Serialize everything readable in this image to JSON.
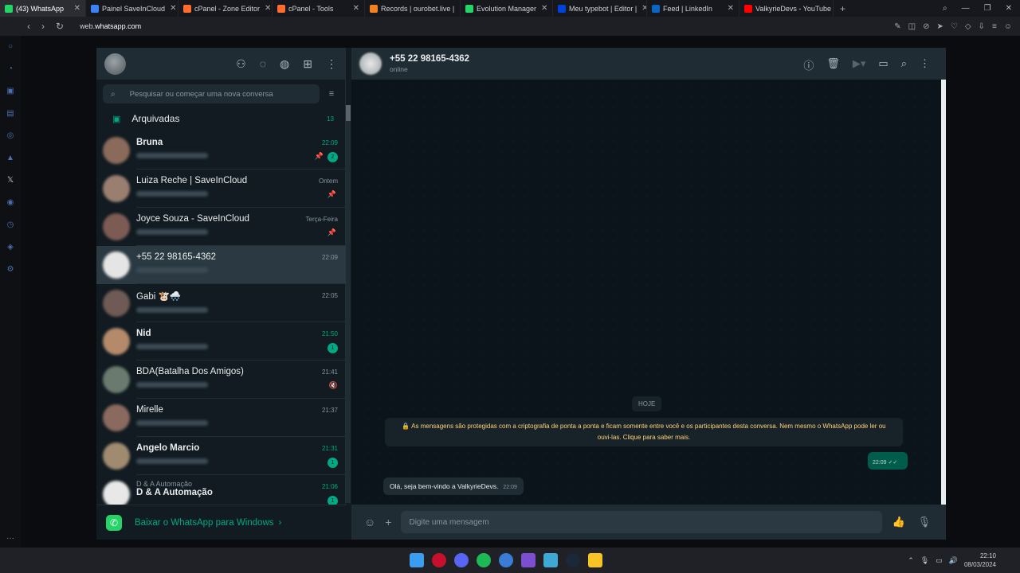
{
  "browser": {
    "tabs": [
      {
        "label": "(43) WhatsApp",
        "color": "#25d366",
        "active": true
      },
      {
        "label": "Painel SaveInCloud",
        "color": "#3b82f6"
      },
      {
        "label": "cPanel - Zone Editor",
        "color": "#ff6c2c"
      },
      {
        "label": "cPanel - Tools",
        "color": "#ff6c2c"
      },
      {
        "label": "Records | ourobet.live |",
        "color": "#f48120"
      },
      {
        "label": "Evolution Manager",
        "color": "#25d366"
      },
      {
        "label": "Meu typebot | Editor |",
        "color": "#0042da"
      },
      {
        "label": "Feed | LinkedIn",
        "color": "#0a66c2"
      },
      {
        "label": "ValkyrieDevs - YouTube",
        "color": "#ff0000"
      }
    ],
    "url_prefix": "web.",
    "url_domain": "whatsapp.com"
  },
  "sidebar": {
    "search_placeholder": "Pesquisar ou começar uma nova conversa",
    "archived_label": "Arquivadas",
    "archived_count": "13",
    "chats": [
      {
        "name": "Bruna",
        "time": "22:09",
        "bold": true,
        "time_green": true,
        "pinned": true,
        "badge": "2",
        "avatar": "#8a6a5a"
      },
      {
        "name": "Luiza Reche | SaveInCloud",
        "time": "Ontem",
        "pinned": true,
        "avatar": "#9a7f70"
      },
      {
        "name": "Joyce Souza - SaveInCloud",
        "time": "Terça-Feira",
        "pinned": true,
        "avatar": "#7d5b55"
      },
      {
        "name": "+55 22 98165-4362",
        "time": "22:09",
        "selected": true,
        "avatar": "#e5e5e5"
      },
      {
        "name": "Gabi 🐮🌨️",
        "time": "22:05",
        "avatar": "#6f5a55"
      },
      {
        "name": "Nid",
        "time": "21:50",
        "bold": true,
        "time_green": true,
        "badge": "1",
        "avatar": "#b48a6a"
      },
      {
        "name": "BDA(Batalha Dos Amigos)",
        "time": "21:41",
        "muted": true,
        "avatar": "#6a7a6e"
      },
      {
        "name": "Mirelle",
        "time": "21:37",
        "avatar": "#8a6a5e"
      },
      {
        "name": "Angelo Marcio",
        "time": "21:31",
        "bold": true,
        "time_green": true,
        "badge": "1",
        "avatar": "#a08a70"
      },
      {
        "name": "D & A Automação",
        "time": "21:06",
        "bold": true,
        "time_green": true,
        "badge": "1",
        "avatar": "#e8e8e8",
        "group_label": "D & A Automação"
      }
    ],
    "download_label": "Baixar o WhatsApp para Windows",
    "download_chevron": "›"
  },
  "chat": {
    "contact_name": "+55 22 98165-4362",
    "status": "online",
    "date_chip": "HOJE",
    "encryption_notice": "🔒 As mensagens são protegidas com a criptografia de ponta a ponta e ficam somente entre você e os participantes desta conversa. Nem mesmo o WhatsApp pode ler ou ouvi-las. Clique para saber mais.",
    "outgoing_time": "22:09",
    "incoming_text": "Olá, seja bem-vindo a ValkyrieDevs.",
    "incoming_time": "22:09",
    "compose_placeholder": "Digite uma mensagem"
  },
  "taskbar": {
    "time": "22:10",
    "date": "08/03/2024"
  }
}
